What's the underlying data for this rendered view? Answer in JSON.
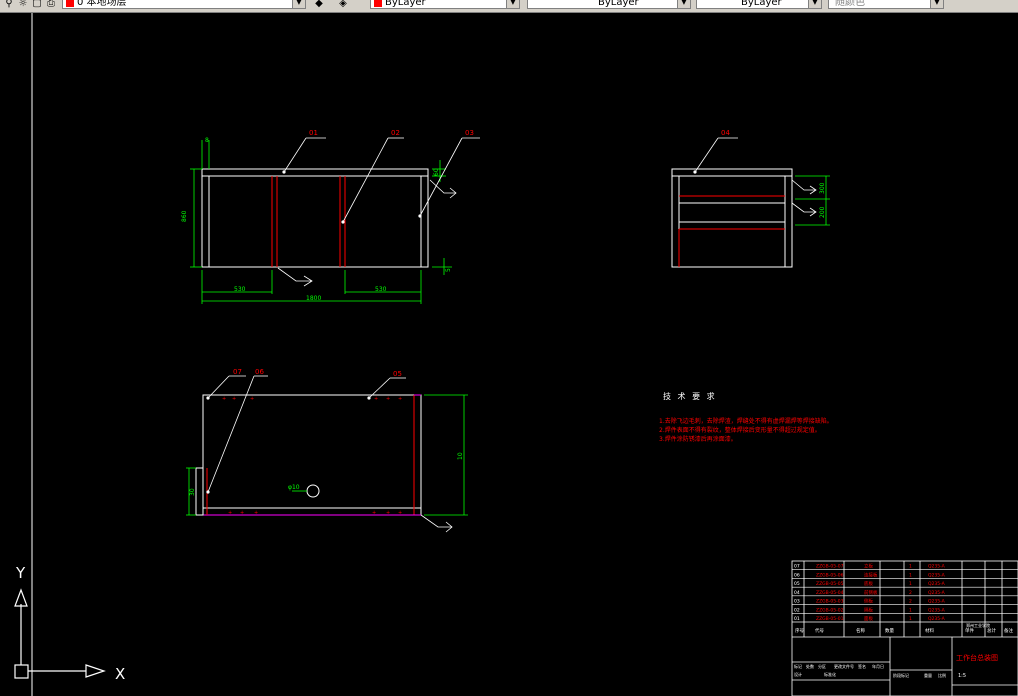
{
  "toolbar": {
    "layer_name": "0 本地场层",
    "color_value": "ByLayer",
    "linetype_value": "ByLayer",
    "lineweight_value": "ByLayer",
    "plotstyle_value": "随颜色",
    "layer_color": "#ff0000"
  },
  "drawing": {
    "view_top": {
      "balloons": [
        "01",
        "02",
        "03"
      ],
      "dims": {
        "left_width": "530",
        "right_width": "530",
        "total_width": "1800",
        "height": "860",
        "top_offset": "8",
        "right_top": "60",
        "right_bottom": "5"
      }
    },
    "view_side": {
      "balloons": [
        "04"
      ],
      "dims": {
        "upper": "300",
        "lower": "200"
      }
    },
    "view_bottom": {
      "balloons": [
        "07",
        "06",
        "05"
      ],
      "dims": {
        "height": "10",
        "hole": "φ10",
        "left_height": "30"
      }
    },
    "notes": {
      "title": "技 术 要 求",
      "lines": [
        "1.去除飞边毛刺，去除焊渣，焊缝处不得有虚焊漏焊等焊接缺陷。",
        "2.焊件表面不得有裂纹，整体焊接后变形量不得超过规定值。",
        "3.焊件涂防锈漆后再涂面漆。"
      ]
    },
    "title_block": {
      "parts": [
        {
          "no": "07",
          "code": "ZZGB-05-07",
          "name": "立板",
          "qty": "1",
          "material": "Q235-A"
        },
        {
          "no": "06",
          "code": "ZZGB-05-06",
          "name": "连接板",
          "qty": "1",
          "material": "Q235-A"
        },
        {
          "no": "05",
          "code": "ZZGB-05-05",
          "name": "底板",
          "qty": "1",
          "material": "Q235-A"
        },
        {
          "no": "04",
          "code": "ZZGB-05-04",
          "name": "前侧板",
          "qty": "2",
          "material": "Q235-A"
        },
        {
          "no": "03",
          "code": "ZZGB-05-03",
          "name": "侧板",
          "qty": "2",
          "material": "Q235-A"
        },
        {
          "no": "02",
          "code": "ZZGB-05-02",
          "name": "隔板",
          "qty": "1",
          "material": "Q235-A"
        },
        {
          "no": "01",
          "code": "ZZGB-05-01",
          "name": "面板",
          "qty": "1",
          "material": "Q235-A"
        }
      ],
      "header": [
        "序号",
        "代号",
        "名称",
        "数量",
        "材料",
        "单件",
        "总计",
        "备注"
      ],
      "company": "郑州工业学院",
      "product": "工作台总装图",
      "scale": "1:5",
      "design_row": [
        "标记",
        "处数",
        "分区",
        "更改文件号",
        "签名",
        "年月日"
      ],
      "sign_row": [
        "设计",
        "标准化",
        "阶段标记",
        "重量",
        "比例"
      ]
    },
    "ucs": {
      "x_label": "X",
      "y_label": "Y"
    }
  },
  "colors": {
    "line": "#ffffff",
    "dim": "#00ff00",
    "balloon": "#ff0000",
    "hidden": "#ff0000"
  }
}
